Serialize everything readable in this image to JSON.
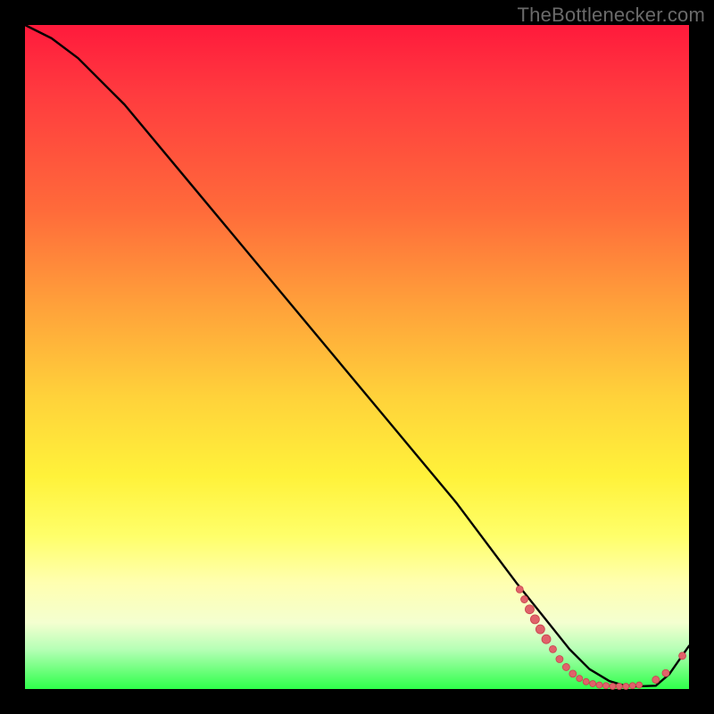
{
  "attribution": "TheBottlenecker.com",
  "colors": {
    "line": "#000000",
    "marker": "#e0626a",
    "marker_stroke": "#c7434d"
  },
  "chart_data": {
    "type": "line",
    "title": "",
    "xlabel": "",
    "ylabel": "",
    "xlim": [
      0,
      100
    ],
    "ylim": [
      0,
      100
    ],
    "series": [
      {
        "name": "curve",
        "x": [
          0,
          4,
          8,
          15,
          25,
          35,
          45,
          55,
          65,
          74,
          78,
          82,
          85,
          88,
          90,
          92,
          95,
          97,
          100
        ],
        "y": [
          100,
          98,
          95,
          88,
          76,
          64,
          52,
          40,
          28,
          16,
          11,
          6,
          3,
          1.2,
          0.6,
          0.4,
          0.5,
          2.2,
          6.5
        ]
      }
    ],
    "markers": [
      {
        "x": 74.5,
        "y": 15.0,
        "r": 4
      },
      {
        "x": 75.2,
        "y": 13.5,
        "r": 4
      },
      {
        "x": 76.0,
        "y": 12.0,
        "r": 5
      },
      {
        "x": 76.8,
        "y": 10.5,
        "r": 5
      },
      {
        "x": 77.6,
        "y": 9.0,
        "r": 5
      },
      {
        "x": 78.5,
        "y": 7.5,
        "r": 5
      },
      {
        "x": 79.5,
        "y": 6.0,
        "r": 4
      },
      {
        "x": 80.5,
        "y": 4.5,
        "r": 4
      },
      {
        "x": 81.5,
        "y": 3.3,
        "r": 4
      },
      {
        "x": 82.5,
        "y": 2.3,
        "r": 4
      },
      {
        "x": 83.5,
        "y": 1.6,
        "r": 3.5
      },
      {
        "x": 84.5,
        "y": 1.1,
        "r": 3.5
      },
      {
        "x": 85.5,
        "y": 0.8,
        "r": 3.5
      },
      {
        "x": 86.5,
        "y": 0.6,
        "r": 3.5
      },
      {
        "x": 87.5,
        "y": 0.5,
        "r": 3.5
      },
      {
        "x": 88.5,
        "y": 0.4,
        "r": 3.5
      },
      {
        "x": 89.5,
        "y": 0.4,
        "r": 3.5
      },
      {
        "x": 90.5,
        "y": 0.4,
        "r": 3.5
      },
      {
        "x": 91.5,
        "y": 0.5,
        "r": 3.5
      },
      {
        "x": 92.5,
        "y": 0.6,
        "r": 3.5
      },
      {
        "x": 95.0,
        "y": 1.4,
        "r": 4
      },
      {
        "x": 96.5,
        "y": 2.4,
        "r": 4
      },
      {
        "x": 99.0,
        "y": 5.0,
        "r": 4
      }
    ]
  }
}
